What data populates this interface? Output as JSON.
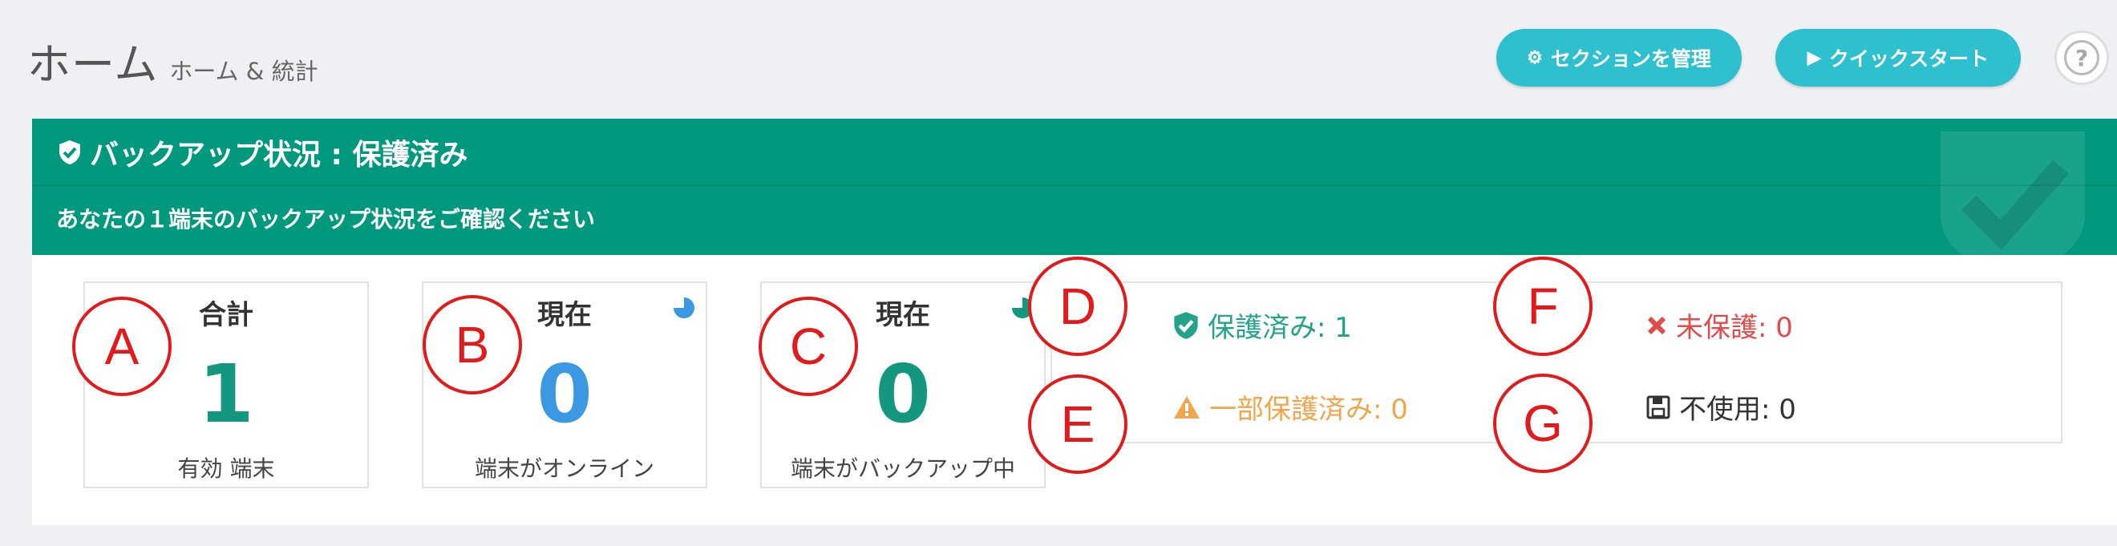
{
  "header": {
    "title": "ホーム",
    "subtitle": "ホーム & 統計",
    "manage_sections_label": "セクションを管理",
    "quick_start_label": "クイックスタート",
    "help_label": "?"
  },
  "backup_status": {
    "title": "バックアップ状況 : 保護済み",
    "description": "あなたの１端末のバックアップ状況をご確認ください"
  },
  "cards": {
    "total": {
      "label": "合計",
      "value": "1",
      "footer": "有効 端末",
      "color": "#13977f"
    },
    "online": {
      "label": "現在",
      "value": "0",
      "footer": "端末がオンライン",
      "color": "#3a99e0"
    },
    "backing_up": {
      "label": "現在",
      "value": "0",
      "footer": "端末がバックアップ中",
      "color": "#13977f"
    }
  },
  "status_summary": {
    "protected": "保護済み: 1",
    "partially_protected": "一部保護済み: 0",
    "unprotected": "未保護: 0",
    "unused": "不使用: 0"
  },
  "callouts": [
    "A",
    "B",
    "C",
    "D",
    "E",
    "F",
    "G"
  ],
  "colors": {
    "accent": "#2fc0cf",
    "status_green": "#00997e",
    "warning": "#f0a64d",
    "danger": "#e04b4b",
    "callout_red": "#e11b1b"
  }
}
